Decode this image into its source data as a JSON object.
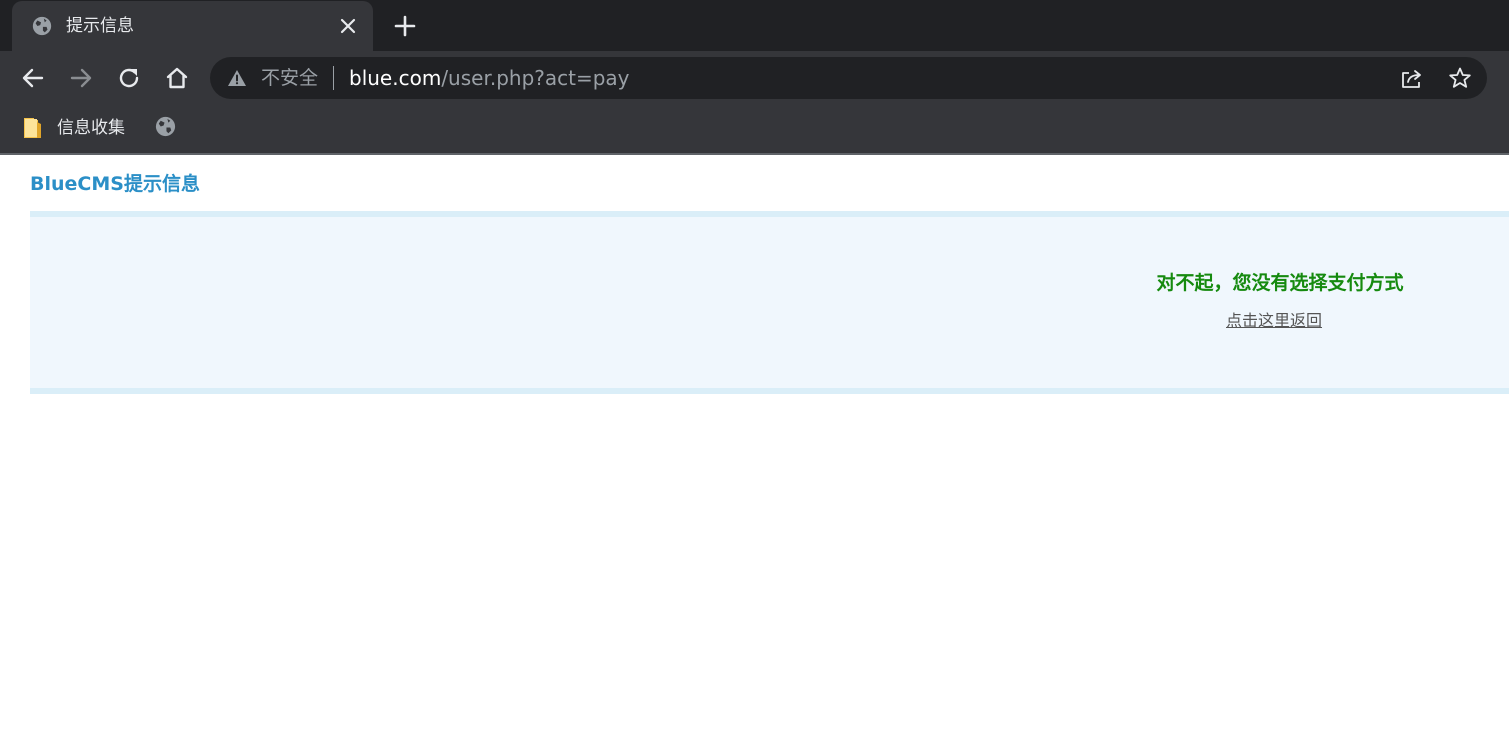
{
  "browser": {
    "tab": {
      "title": "提示信息",
      "icon": "globe-icon",
      "close_icon": "close-icon"
    },
    "new_tab_icon": "plus-icon",
    "toolbar": {
      "back_icon": "arrow-left-icon",
      "forward_icon": "arrow-right-icon",
      "reload_icon": "reload-icon",
      "home_icon": "home-icon"
    },
    "omnibox": {
      "security_icon": "warning-icon",
      "security_label": "不安全",
      "url_host": "blue.com",
      "url_path": "/user.php?act=pay",
      "share_icon": "share-icon",
      "bookmark_icon": "star-icon"
    },
    "bookmarks": [
      {
        "label": "信息收集",
        "icon": "folder-icon"
      },
      {
        "label": "",
        "icon": "globe-icon"
      }
    ]
  },
  "page": {
    "title": "BlueCMS提示信息",
    "message": "对不起，您没有选择支付方式",
    "back_link": "点击这里返回"
  },
  "colors": {
    "chrome_dark": "#202124",
    "chrome_toolbar": "#35363a",
    "title_blue": "#2b8fc7",
    "message_green": "#168a0f",
    "box_bg": "#f0f7fd",
    "box_border": "#daeef8"
  }
}
